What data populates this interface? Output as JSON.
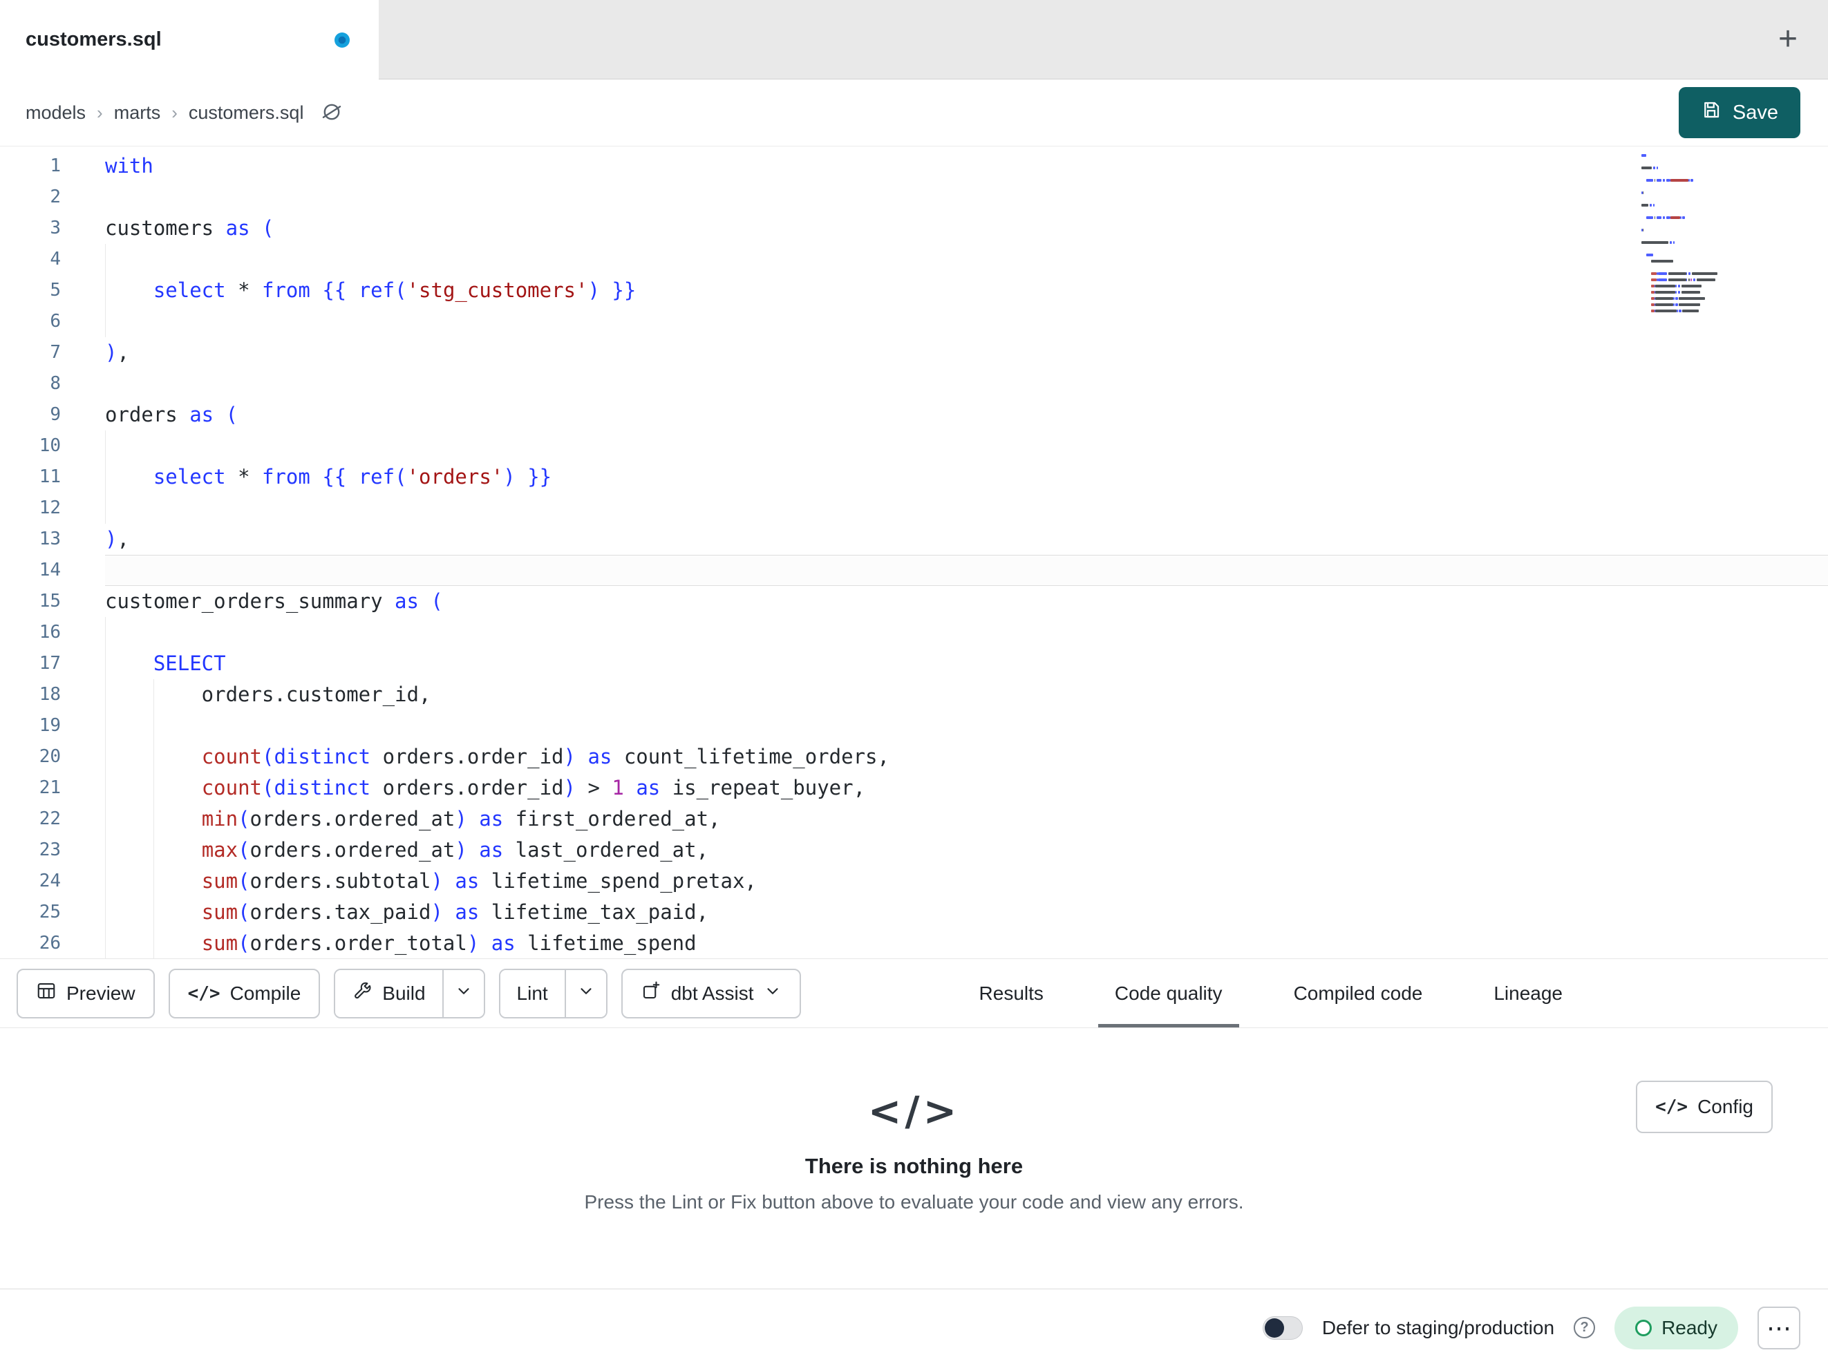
{
  "tab_bar": {
    "active_tab": "customers.sql",
    "new_tab": "+"
  },
  "breadcrumb": {
    "items": [
      "models",
      "marts",
      "customers.sql"
    ]
  },
  "actions": {
    "save": "Save"
  },
  "toolbar": {
    "preview": "Preview",
    "compile": "Compile",
    "build": "Build",
    "lint": "Lint",
    "assist": "dbt Assist"
  },
  "panel": {
    "tabs": [
      {
        "label": "Results",
        "active": false
      },
      {
        "label": "Code quality",
        "active": true
      },
      {
        "label": "Compiled code",
        "active": false
      },
      {
        "label": "Lineage",
        "active": false
      }
    ]
  },
  "empty_state": {
    "title": "There is nothing here",
    "subtitle": "Press the Lint or Fix button above to evaluate your code and view any errors.",
    "config": "Config"
  },
  "status_bar": {
    "defer": "Defer to staging/production",
    "ready": "Ready"
  },
  "icons": {
    "tab_status": "unsaved-dot-icon",
    "new_tab": "plus-icon",
    "breadcrumb_action": "orbit-icon",
    "save": "floppy-icon",
    "preview": "table-icon",
    "compile": "code-icon",
    "build": "wrench-icon",
    "dropdown": "chevron-down-icon",
    "assist": "sparkle-square-icon",
    "empty_state": "code-icon",
    "config": "code-icon",
    "help": "question-circle-icon",
    "ready": "status-ring-icon",
    "more": "ellipsis-icon"
  },
  "theme": {
    "save_button": "#0f5f63",
    "ready_bg": "#d7f2e3",
    "ready_text": "#173a2d",
    "ready_ring": "#1f9d5f",
    "unsaved_dot": "#15a1dd",
    "unsaved_dot_center": "#0b72b5",
    "accent_keyword": "#2337ff"
  },
  "editor": {
    "colors": {
      "kw": "#2337ff",
      "fn": "#b32b26",
      "str": "#a31515",
      "num": "#a626a4",
      "paren": "#2337ff",
      "brace": "#2337ff",
      "op": "#24292e",
      "txt": "#24292e",
      "ln": "#54718f"
    },
    "lines": [
      {
        "n": 1,
        "tokens": [
          [
            "kw",
            "with"
          ]
        ]
      },
      {
        "n": 2,
        "tokens": []
      },
      {
        "n": 3,
        "tokens": [
          [
            "txt",
            "customers "
          ],
          [
            "kw",
            "as"
          ],
          [
            "txt",
            " "
          ],
          [
            "paren",
            "("
          ]
        ]
      },
      {
        "n": 4,
        "guides": 1,
        "tokens": []
      },
      {
        "n": 5,
        "guides": 1,
        "tokens": [
          [
            "txt",
            "    "
          ],
          [
            "kw",
            "select"
          ],
          [
            "txt",
            " "
          ],
          [
            "op",
            "*"
          ],
          [
            "txt",
            " "
          ],
          [
            "kw",
            "from"
          ],
          [
            "txt",
            " "
          ],
          [
            "brace",
            "{{ "
          ],
          [
            "kw",
            "ref"
          ],
          [
            "paren",
            "("
          ],
          [
            "str",
            "'stg_customers'"
          ],
          [
            "paren",
            ")"
          ],
          [
            "brace",
            " }}"
          ]
        ]
      },
      {
        "n": 6,
        "guides": 1,
        "tokens": []
      },
      {
        "n": 7,
        "tokens": [
          [
            "paren",
            ")"
          ],
          [
            "txt",
            ","
          ]
        ]
      },
      {
        "n": 8,
        "tokens": []
      },
      {
        "n": 9,
        "tokens": [
          [
            "txt",
            "orders "
          ],
          [
            "kw",
            "as"
          ],
          [
            "txt",
            " "
          ],
          [
            "paren",
            "("
          ]
        ]
      },
      {
        "n": 10,
        "guides": 1,
        "tokens": []
      },
      {
        "n": 11,
        "guides": 1,
        "tokens": [
          [
            "txt",
            "    "
          ],
          [
            "kw",
            "select"
          ],
          [
            "txt",
            " "
          ],
          [
            "op",
            "*"
          ],
          [
            "txt",
            " "
          ],
          [
            "kw",
            "from"
          ],
          [
            "txt",
            " "
          ],
          [
            "brace",
            "{{ "
          ],
          [
            "kw",
            "ref"
          ],
          [
            "paren",
            "("
          ],
          [
            "str",
            "'orders'"
          ],
          [
            "paren",
            ")"
          ],
          [
            "brace",
            " }}"
          ]
        ]
      },
      {
        "n": 12,
        "guides": 1,
        "tokens": []
      },
      {
        "n": 13,
        "tokens": [
          [
            "paren",
            ")"
          ],
          [
            "txt",
            ","
          ]
        ]
      },
      {
        "n": 14,
        "active": true,
        "tokens": []
      },
      {
        "n": 15,
        "tokens": [
          [
            "txt",
            "customer_orders_summary "
          ],
          [
            "kw",
            "as"
          ],
          [
            "txt",
            " "
          ],
          [
            "paren",
            "("
          ]
        ]
      },
      {
        "n": 16,
        "guides": 1,
        "tokens": []
      },
      {
        "n": 17,
        "guides": 1,
        "tokens": [
          [
            "txt",
            "    "
          ],
          [
            "kw",
            "SELECT"
          ]
        ]
      },
      {
        "n": 18,
        "guides": 2,
        "tokens": [
          [
            "txt",
            "        orders.customer_id,"
          ]
        ]
      },
      {
        "n": 19,
        "guides": 2,
        "tokens": []
      },
      {
        "n": 20,
        "guides": 2,
        "tokens": [
          [
            "txt",
            "        "
          ],
          [
            "fn",
            "count"
          ],
          [
            "paren",
            "("
          ],
          [
            "kw",
            "distinct"
          ],
          [
            "txt",
            " orders.order_id"
          ],
          [
            "paren",
            ")"
          ],
          [
            "txt",
            " "
          ],
          [
            "kw",
            "as"
          ],
          [
            "txt",
            " count_lifetime_orders,"
          ]
        ]
      },
      {
        "n": 21,
        "guides": 2,
        "tokens": [
          [
            "txt",
            "        "
          ],
          [
            "fn",
            "count"
          ],
          [
            "paren",
            "("
          ],
          [
            "kw",
            "distinct"
          ],
          [
            "txt",
            " orders.order_id"
          ],
          [
            "paren",
            ")"
          ],
          [
            "txt",
            " "
          ],
          [
            "op",
            ">"
          ],
          [
            "txt",
            " "
          ],
          [
            "num",
            "1"
          ],
          [
            "txt",
            " "
          ],
          [
            "kw",
            "as"
          ],
          [
            "txt",
            " is_repeat_buyer,"
          ]
        ]
      },
      {
        "n": 22,
        "guides": 2,
        "tokens": [
          [
            "txt",
            "        "
          ],
          [
            "fn",
            "min"
          ],
          [
            "paren",
            "("
          ],
          [
            "txt",
            "orders.ordered_at"
          ],
          [
            "paren",
            ")"
          ],
          [
            "txt",
            " "
          ],
          [
            "kw",
            "as"
          ],
          [
            "txt",
            " first_ordered_at,"
          ]
        ]
      },
      {
        "n": 23,
        "guides": 2,
        "tokens": [
          [
            "txt",
            "        "
          ],
          [
            "fn",
            "max"
          ],
          [
            "paren",
            "("
          ],
          [
            "txt",
            "orders.ordered_at"
          ],
          [
            "paren",
            ")"
          ],
          [
            "txt",
            " "
          ],
          [
            "kw",
            "as"
          ],
          [
            "txt",
            " last_ordered_at,"
          ]
        ]
      },
      {
        "n": 24,
        "guides": 2,
        "tokens": [
          [
            "txt",
            "        "
          ],
          [
            "fn",
            "sum"
          ],
          [
            "paren",
            "("
          ],
          [
            "txt",
            "orders.subtotal"
          ],
          [
            "paren",
            ")"
          ],
          [
            "txt",
            " "
          ],
          [
            "kw",
            "as"
          ],
          [
            "txt",
            " lifetime_spend_pretax,"
          ]
        ]
      },
      {
        "n": 25,
        "guides": 2,
        "tokens": [
          [
            "txt",
            "        "
          ],
          [
            "fn",
            "sum"
          ],
          [
            "paren",
            "("
          ],
          [
            "txt",
            "orders.tax_paid"
          ],
          [
            "paren",
            ")"
          ],
          [
            "txt",
            " "
          ],
          [
            "kw",
            "as"
          ],
          [
            "txt",
            " lifetime_tax_paid,"
          ]
        ]
      },
      {
        "n": 26,
        "guides": 2,
        "tokens": [
          [
            "txt",
            "        "
          ],
          [
            "fn",
            "sum"
          ],
          [
            "paren",
            "("
          ],
          [
            "txt",
            "orders.order_total"
          ],
          [
            "paren",
            ")"
          ],
          [
            "txt",
            " "
          ],
          [
            "kw",
            "as"
          ],
          [
            "txt",
            " lifetime_spend"
          ]
        ]
      }
    ]
  }
}
